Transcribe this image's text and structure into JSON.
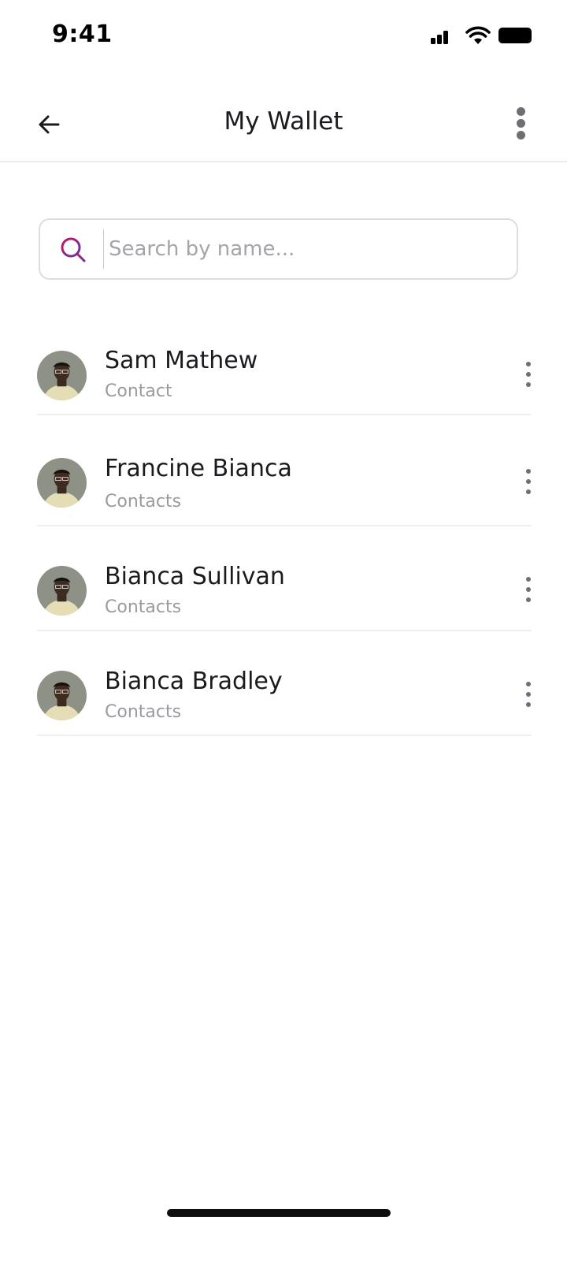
{
  "status_bar": {
    "time": "9:41"
  },
  "header": {
    "title": "My Wallet"
  },
  "search": {
    "placeholder": "Search by name...",
    "value": ""
  },
  "colors": {
    "search_icon_start": "#c2185b",
    "search_icon_end": "#5e35b1",
    "divider": "#efeff1",
    "secondary_text": "#9a9aa0"
  },
  "icons": {
    "back": "arrow-left-icon",
    "more": "more-vertical-icon",
    "search": "search-icon"
  },
  "contacts": [
    {
      "name": "Sam Mathew",
      "subtitle": "Contact"
    },
    {
      "name": "Francine Bianca",
      "subtitle": "Contacts"
    },
    {
      "name": "Bianca Sullivan",
      "subtitle": "Contacts"
    },
    {
      "name": "Bianca Bradley",
      "subtitle": "Contacts"
    }
  ]
}
